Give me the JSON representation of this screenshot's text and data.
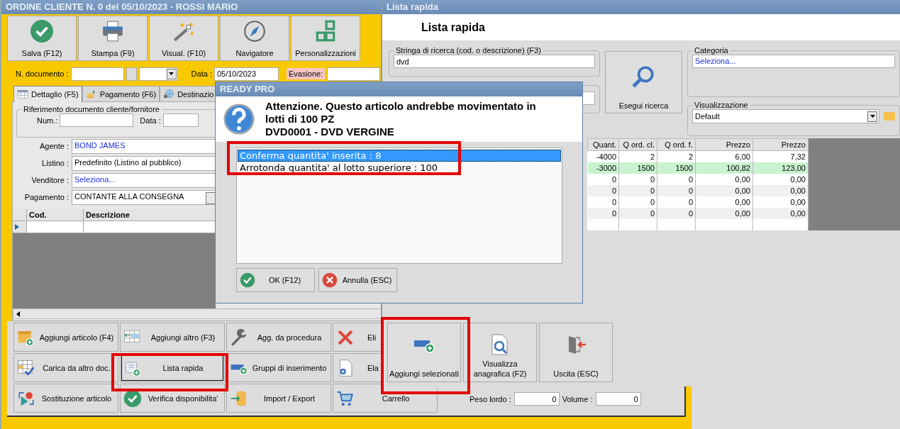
{
  "main_window": {
    "title": "ORDINE CLIENTE N. 0 del 05/10/2023 - ROSSI MARIO",
    "toolbar": [
      {
        "label": "Salva (F12)",
        "kind": "save"
      },
      {
        "label": "Stampa (F9)",
        "kind": "print"
      },
      {
        "label": "Visual. (F10)",
        "kind": "view"
      },
      {
        "label": "Navigatore",
        "kind": "compass"
      },
      {
        "label": "Personalizzazioni",
        "kind": "squares"
      }
    ],
    "header_fields": {
      "number_label": "N. documento :",
      "date_label": "Data :",
      "date_value": "05/10/2023",
      "evasione_label": "Evasione:"
    },
    "tabs": [
      {
        "label": "Dettaglio (F5)",
        "selected": true,
        "kind": "table"
      },
      {
        "label": "Pagamento (F6)",
        "selected": false,
        "kind": "money"
      },
      {
        "label": "Destinazio",
        "selected": false,
        "kind": "globe"
      }
    ],
    "reference_group": {
      "title": "Riferimento documento cliente/fornitore",
      "num_label": "Num.:",
      "date_label": "Data :"
    },
    "fields": [
      {
        "label": "Agente :",
        "value": "BOND JAMES",
        "kind": "lookup"
      },
      {
        "label": "Listino :",
        "value": "Predefinito (Listino al pubblico)",
        "kind": "text"
      },
      {
        "label": "Venditore :",
        "value": "Seleziona...",
        "kind": "lookup"
      },
      {
        "label": "Pagamento :",
        "value": "CONTANTE ALLA CONSEGNA",
        "kind": "select"
      }
    ],
    "grid": {
      "columns": [
        "Cod.",
        "Descrizione"
      ]
    },
    "buttons": [
      {
        "label": "Aggiungi articolo (F4)",
        "kind": "add-article",
        "focused": false
      },
      {
        "label": "Aggiungi altro (F3)",
        "kind": "add-other",
        "focused": false
      },
      {
        "label": "Agg. da procedura",
        "kind": "procedure",
        "focused": false
      },
      {
        "label": "Eli",
        "kind": "delete",
        "focused": false
      },
      {
        "label": "Carica da altro doc.",
        "kind": "load",
        "focused": false
      },
      {
        "label": "Lista rapida",
        "kind": "quick-list",
        "focused": true
      },
      {
        "label": "Gruppi di inserimento",
        "kind": "groups",
        "focused": false
      },
      {
        "label": "Ela",
        "kind": "process",
        "focused": false
      },
      {
        "label": "Sostituzione articolo",
        "kind": "replace",
        "focused": false
      },
      {
        "label": "Verifica disponibilita'",
        "kind": "check",
        "focused": false
      },
      {
        "label": "Import / Export",
        "kind": "import",
        "focused": false
      },
      {
        "label": "Carrello",
        "kind": "cart",
        "focused": false
      }
    ],
    "weights": {
      "gross_label": "Peso lordo :",
      "gross_value": "0",
      "volume_label": "Volume :",
      "volume_value": "0"
    }
  },
  "quick_list": {
    "title": "Lista rapida",
    "heading": "Lista rapida",
    "search": {
      "label": "Stringa di ricerca (cod. o descrizione) (F3)",
      "value": "dvd"
    },
    "search_button": "Esegui ricerca",
    "category": {
      "label": "Categoria",
      "value": "Seleziona..."
    },
    "view": {
      "label": "Visualizzazione",
      "value": "Default"
    },
    "table": {
      "columns": [
        "Quant.",
        "Q ord. cl.",
        "Q ord. f.",
        "Prezzo",
        "Prezzo"
      ],
      "rows": [
        {
          "cells": [
            "-4000",
            "2",
            "2",
            "6,00",
            "7,32"
          ],
          "selected": false
        },
        {
          "cells": [
            "-3000",
            "1500",
            "1500",
            "100,82",
            "123,00"
          ],
          "selected": true
        },
        {
          "cells": [
            "0",
            "0",
            "0",
            "0,00",
            "0,00"
          ],
          "selected": false
        },
        {
          "cells": [
            "0",
            "0",
            "0",
            "0,00",
            "0,00"
          ],
          "selected": false
        },
        {
          "cells": [
            "0",
            "0",
            "0",
            "0,00",
            "0,00"
          ],
          "selected": false
        },
        {
          "cells": [
            "0",
            "0",
            "0",
            "0,00",
            "0,00"
          ],
          "selected": false
        }
      ]
    },
    "buttons": [
      {
        "label": "Aggiungi selezionati",
        "kind": "add-selected"
      },
      {
        "label": "Visualizza anagrafica (F2)",
        "kind": "view-doc"
      },
      {
        "label": "Uscita (ESC)",
        "kind": "exit"
      }
    ]
  },
  "dialog": {
    "title": "READY PRO",
    "message": "Attenzione. Questo articolo andrebbe movimentato in lotti di 100 PZ",
    "article": "DVD0001 - DVD VERGINE",
    "options": [
      {
        "label": "Conferma quantita' inserita : 8",
        "selected": true
      },
      {
        "label": "Arrotonda quantita' al lotto superiore : 100",
        "selected": false
      }
    ],
    "buttons": [
      {
        "label": "OK (F12)",
        "kind": "ok"
      },
      {
        "label": "Annulla (ESC)",
        "kind": "cancel"
      }
    ]
  }
}
